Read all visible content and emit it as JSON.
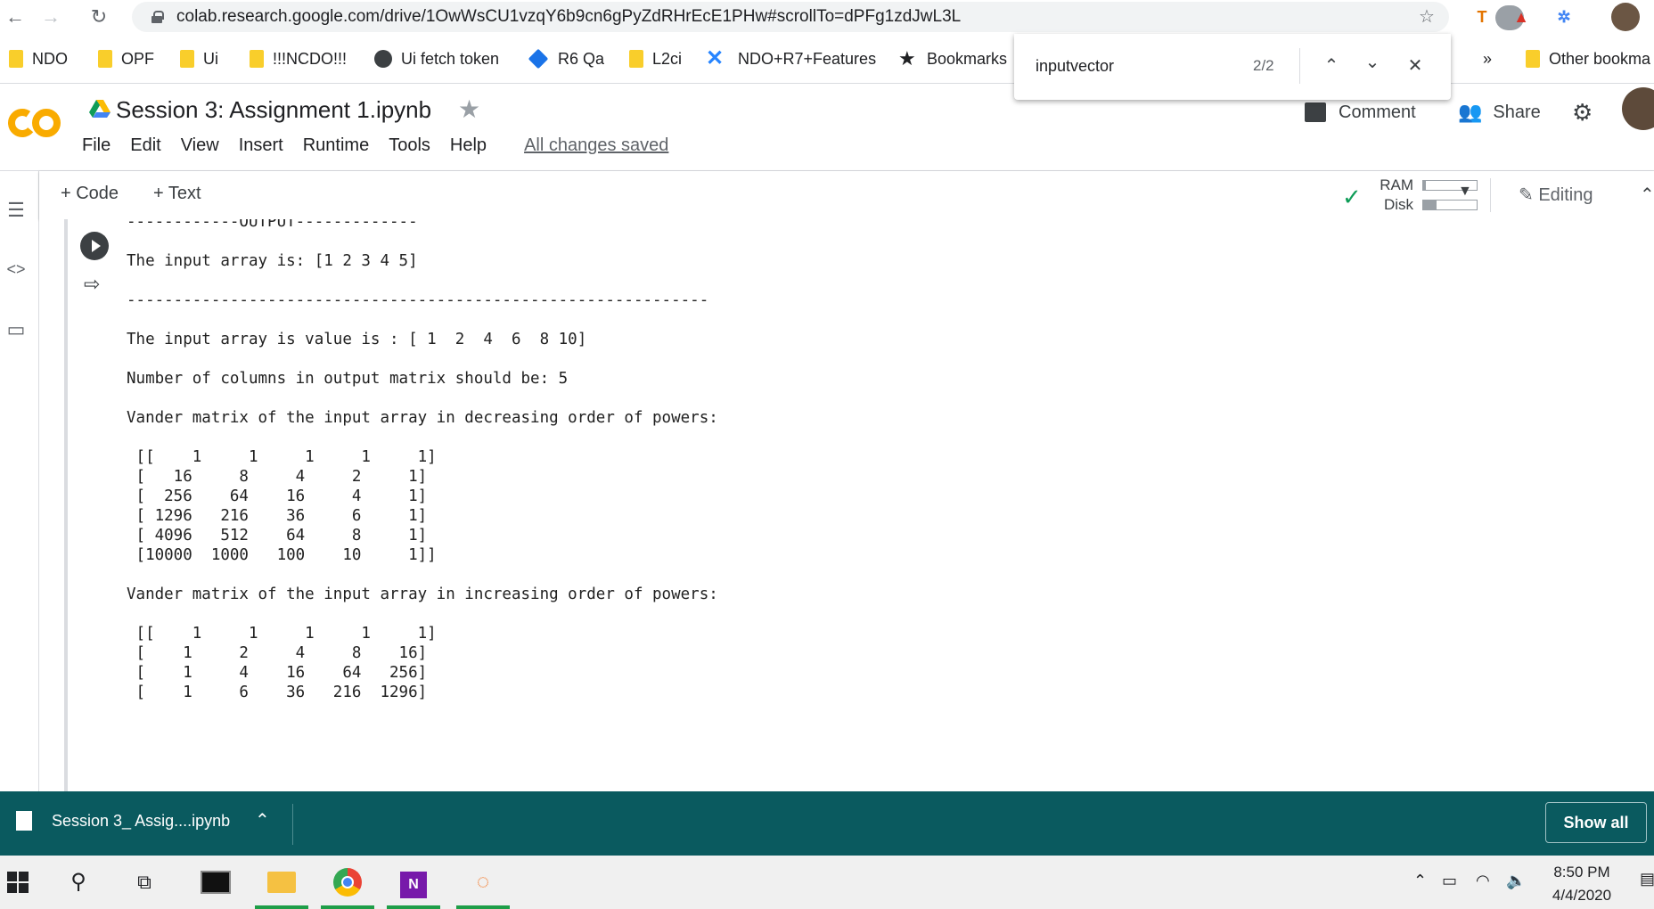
{
  "browser": {
    "url": "colab.research.google.com/drive/1OwWsCU1vzqY6b9cn6gPyZdRHrEcE1PHw#scrollTo=dPFg1zdJwL3L"
  },
  "bookmarks": [
    {
      "label": "NDO"
    },
    {
      "label": "OPF"
    },
    {
      "label": "Ui"
    },
    {
      "label": "!!!NCDO!!!"
    },
    {
      "label": "Ui fetch token"
    },
    {
      "label": "R6 Qa"
    },
    {
      "label": "L2ci"
    },
    {
      "label": "NDO+R7+Features"
    },
    {
      "label": "Bookmarks"
    }
  ],
  "bookmarks_overflow": "»",
  "other_bookmarks": "Other bookma",
  "find": {
    "query": "inputvector",
    "count": "2/2"
  },
  "notebook": {
    "logo": "CO",
    "title": "Session 3: Assignment 1.ipynb",
    "menu": [
      "File",
      "Edit",
      "View",
      "Insert",
      "Runtime",
      "Tools",
      "Help"
    ],
    "saved_status": "All changes saved",
    "comment_label": "Comment",
    "share_label": "Share"
  },
  "toolbar": {
    "code_label": "+ Code",
    "text_label": "+ Text",
    "ram_label": "RAM",
    "disk_label": "Disk",
    "ram_usage": 0.05,
    "disk_usage": 0.25,
    "editing_label": "Editing"
  },
  "output": {
    "lines": [
      "------------OUTPUT-------------",
      "",
      "The input array is: [1 2 3 4 5]",
      "",
      "--------------------------------------------------------------",
      "",
      "The input array is value is : [ 1  2  4  6  8 10]",
      "",
      "Number of columns in output matrix should be: 5",
      "",
      "Vander matrix of the input array in decreasing order of powers:",
      "",
      " [[    1     1     1     1     1]",
      " [   16     8     4     2     1]",
      " [  256    64    16     4     1]",
      " [ 1296   216    36     6     1]",
      " [ 4096   512    64     8     1]",
      " [10000  1000   100    10     1]]",
      "",
      "Vander matrix of the input array in increasing order of powers:",
      "",
      " [[    1     1     1     1     1]",
      " [    1     2     4     8    16]",
      " [    1     4    16    64   256]",
      " [    1     6    36   216  1296]"
    ]
  },
  "download": {
    "filename": "Session 3_ Assig....ipynb",
    "show_all": "Show all"
  },
  "taskbar": {
    "time": "8:50 PM",
    "date": "4/4/2020"
  },
  "colors": {
    "shelf": "#0a5a5f",
    "colab_orange": "#f9ab00",
    "check_green": "#0f9d58"
  }
}
